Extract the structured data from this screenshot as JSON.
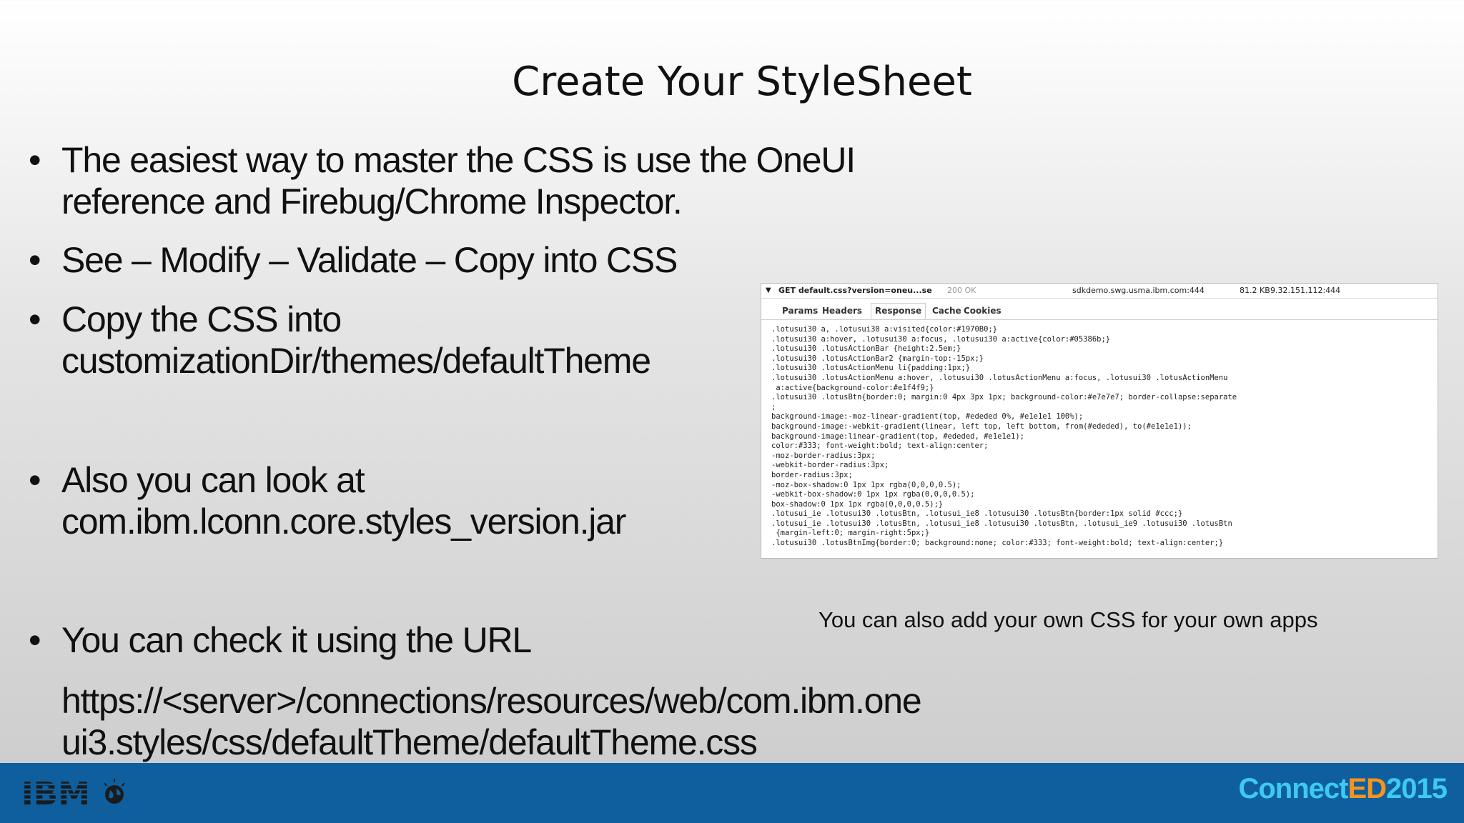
{
  "title": "Create Your StyleSheet",
  "bullets": [
    {
      "lines": [
        "The easiest way to master the CSS is use the OneUI",
        "reference and Firebug/Chrome Inspector."
      ]
    },
    {
      "lines": [
        "See – Modify – Validate – Copy into CSS"
      ]
    },
    {
      "lines": [
        "Copy the CSS into",
        "customizationDir/themes/defaultTheme"
      ]
    },
    {
      "lines": [
        "Also you can look at",
        "com.ibm.lconn.core.styles_version.jar"
      ]
    },
    {
      "lines": [
        "You can check it using the URL"
      ]
    }
  ],
  "bullet_glyph": "•",
  "url_lines": [
    "https://<server>/connections/resources/web/com.ibm.one",
    "ui3.styles/css/defaultTheme/defaultTheme.css"
  ],
  "inspector": {
    "request": "GET default.css?version=oneu...se",
    "status": "200 OK",
    "host": "sdkdemo.swg.usma.ibm.com:444",
    "size": "81.2 KB",
    "ip": "9.32.151.112:444",
    "tabs": [
      "Params",
      "Headers",
      "Response",
      "Cache",
      "Cookies"
    ],
    "active_tab": "Response",
    "code": ".lotusui30 a, .lotusui30 a:visited{color:#1970B0;}\n.lotusui30 a:hover, .lotusui30 a:focus, .lotusui30 a:active{color:#05386b;}\n.lotusui30 .lotusActionBar {height:2.5em;}\n.lotusui30 .lotusActionBar2 {margin-top:-15px;}\n.lotusui30 .lotusActionMenu li{padding:1px;}\n.lotusui30 .lotusActionMenu a:hover, .lotusui30 .lotusActionMenu a:focus, .lotusui30 .lotusActionMenu\n a:active{background-color:#e1f4f9;}\n.lotusui30 .lotusBtn{border:0; margin:0 4px 3px 1px; background-color:#e7e7e7; border-collapse:separate\n;\nbackground-image:-moz-linear-gradient(top, #ededed 0%, #e1e1e1 100%);\nbackground-image:-webkit-gradient(linear, left top, left bottom, from(#ededed), to(#e1e1e1));\nbackground-image:linear-gradient(top, #ededed, #e1e1e1);\ncolor:#333; font-weight:bold; text-align:center;\n-moz-border-radius:3px;\n-webkit-border-radius:3px;\nborder-radius:3px;\n-moz-box-shadow:0 1px 1px rgba(0,0,0,0.5);\n-webkit-box-shadow:0 1px 1px rgba(0,0,0,0.5);\nbox-shadow:0 1px 1px rgba(0,0,0,0.5);}\n.lotusui_ie .lotusui30 .lotusBtn, .lotusui_ie8 .lotusui30 .lotusBtn{border:1px solid #ccc;}\n.lotusui_ie .lotusui30 .lotusBtn, .lotusui_ie8 .lotusui30 .lotusBtn, .lotusui_ie9 .lotusui30 .lotusBtn\n {margin-left:0; margin-right:5px;}\n.lotusui30 .lotusBtnImg{border:0; background:none; color:#333; font-weight:bold; text-align:center;}"
  },
  "note": "You can also add your own CSS for your own apps",
  "footer": {
    "logo_text": "IBM",
    "brand_a": "Connect",
    "brand_b": "ED",
    "brand_c": "2015",
    "colors": {
      "bar": "#0f5f9e",
      "connect": "#3ec9f1",
      "ed": "#f7941d",
      "year": "#3ec9f1"
    }
  }
}
